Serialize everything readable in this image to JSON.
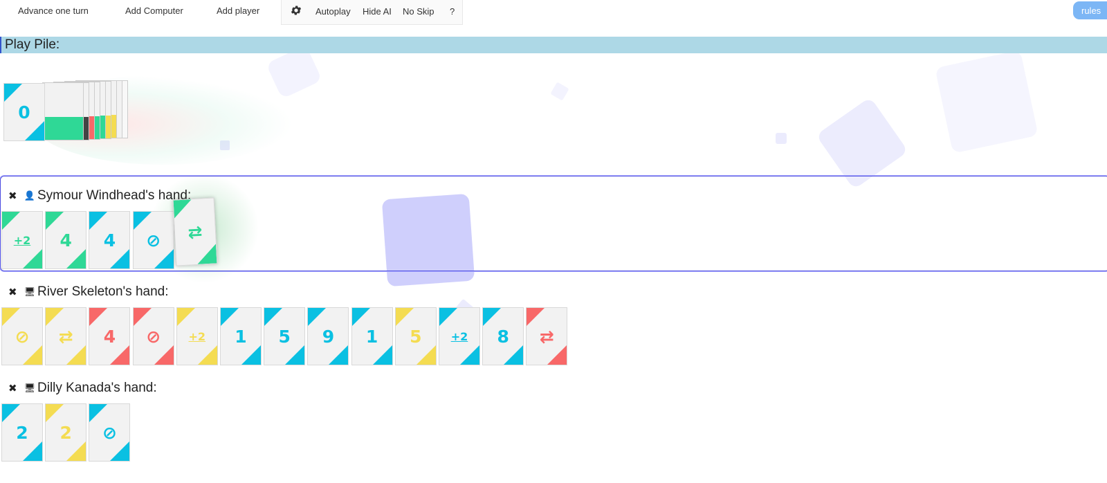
{
  "toolbar": {
    "advance_label": "Advance one turn",
    "add_computer_label": "Add Computer",
    "add_player_label": "Add player",
    "settings_icon": "gear-icon",
    "autoplay_label": "Autoplay",
    "hide_ai_label": "Hide AI",
    "no_skip_label": "No Skip",
    "help_label": "?",
    "rules_label": "rules"
  },
  "play_pile": {
    "title": "Play Pile:",
    "top_card": {
      "color": "blue",
      "symbol": "0"
    }
  },
  "colors": {
    "green": "#2fd896",
    "blue": "#0ac0e2",
    "yellow": "#f4dc52",
    "red": "#f86868",
    "header_bg": "#add8e6",
    "rules_bg": "#7cb6f5"
  },
  "hands": [
    {
      "name": "Symour Windhead's hand:",
      "player_icon": "person-icon",
      "current": true,
      "cards": [
        {
          "color": "green",
          "symbol": "+2",
          "kind": "draw2"
        },
        {
          "color": "green",
          "symbol": "4",
          "kind": "number"
        },
        {
          "color": "blue",
          "symbol": "4",
          "kind": "number"
        },
        {
          "color": "blue",
          "symbol": "⊘",
          "kind": "skip"
        },
        {
          "color": "green",
          "symbol": "⇄",
          "kind": "reverse"
        }
      ]
    },
    {
      "name": "River Skeleton's hand:",
      "player_icon": "computer-icon",
      "current": false,
      "cards": [
        {
          "color": "yellow",
          "symbol": "⊘",
          "kind": "skip"
        },
        {
          "color": "yellow",
          "symbol": "⇄",
          "kind": "reverse"
        },
        {
          "color": "red",
          "symbol": "4",
          "kind": "number"
        },
        {
          "color": "red",
          "symbol": "⊘",
          "kind": "skip"
        },
        {
          "color": "yellow",
          "symbol": "+2",
          "kind": "draw2"
        },
        {
          "color": "blue",
          "symbol": "1",
          "kind": "number"
        },
        {
          "color": "blue",
          "symbol": "5",
          "kind": "number"
        },
        {
          "color": "blue",
          "symbol": "9",
          "kind": "number"
        },
        {
          "color": "blue",
          "symbol": "1",
          "kind": "number"
        },
        {
          "color": "yellow",
          "symbol": "5",
          "kind": "number"
        },
        {
          "color": "blue",
          "symbol": "+2",
          "kind": "draw2"
        },
        {
          "color": "blue",
          "symbol": "8",
          "kind": "number"
        },
        {
          "color": "red",
          "symbol": "⇄",
          "kind": "reverse"
        }
      ]
    },
    {
      "name": "Dilly Kanada's hand:",
      "player_icon": "computer-icon",
      "current": false,
      "cards": [
        {
          "color": "blue",
          "symbol": "2",
          "kind": "number"
        },
        {
          "color": "yellow",
          "symbol": "2",
          "kind": "number"
        },
        {
          "color": "blue",
          "symbol": "⊘",
          "kind": "skip"
        }
      ]
    }
  ]
}
